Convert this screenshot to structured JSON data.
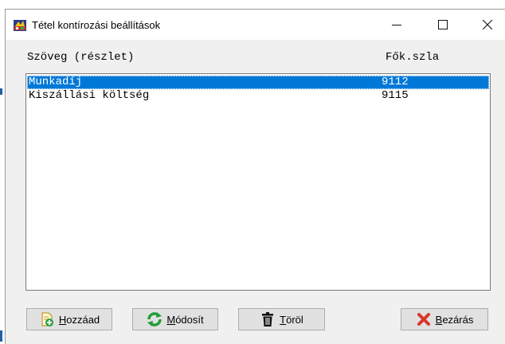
{
  "window": {
    "title": "Tétel kontírozási beállítások",
    "app_icon": "colorful-app-icon",
    "controls": {
      "minimize_icon": "minimize-icon",
      "maximize_icon": "maximize-icon",
      "close_icon": "close-icon"
    }
  },
  "list": {
    "headers": {
      "text": "Szöveg (részlet)",
      "account": "Fők.szla"
    },
    "rows": [
      {
        "text": "Munkadíj",
        "account": "9112",
        "selected": true
      },
      {
        "text": "Kiszállási költség",
        "account": "9115",
        "selected": false
      }
    ]
  },
  "buttons": {
    "add": {
      "mnemonic": "H",
      "rest": "ozzáad",
      "icon": "add-document-icon"
    },
    "edit": {
      "mnemonic": "M",
      "rest": "ódosít",
      "icon": "refresh-icon"
    },
    "delete": {
      "mnemonic": "T",
      "rest": "öröl",
      "icon": "trash-icon"
    },
    "close": {
      "mnemonic": "B",
      "rest": "ezárás",
      "icon": "red-x-icon"
    }
  },
  "colors": {
    "selection": "#0078d7",
    "close_x": "#d9372b",
    "refresh": "#1f9d3a"
  }
}
